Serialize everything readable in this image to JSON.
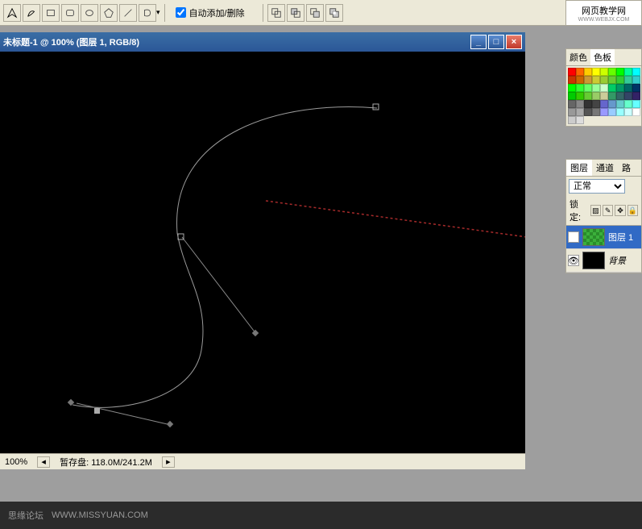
{
  "toolbar": {
    "checkbox_label": "自动添加/删除",
    "tool_icons": [
      "pen",
      "freeform-pen",
      "rect",
      "rounded-rect",
      "ellipse",
      "polygon",
      "line",
      "custom-shape"
    ],
    "group2_icons": [
      "path-combine",
      "path-subtract",
      "path-intersect",
      "path-exclude"
    ]
  },
  "logo": {
    "text": "网页教学网",
    "sub": "WWW.WEBJX.COM"
  },
  "panels": {
    "swatch": {
      "tabs": [
        "颜色",
        "色板"
      ],
      "active_tab": 1,
      "colors": [
        "#ff0000",
        "#ff6600",
        "#ffcc00",
        "#ffff00",
        "#ccff00",
        "#66ff00",
        "#00ff00",
        "#00ff99",
        "#00ffff",
        "#cc3300",
        "#cc6600",
        "#cc9933",
        "#cccc33",
        "#99cc33",
        "#66cc33",
        "#33cc33",
        "#33cc99",
        "#33cccc",
        "#00ff00",
        "#33ff33",
        "#66ff66",
        "#99ff99",
        "#ccffcc",
        "#00cc66",
        "#009966",
        "#006666",
        "#003366",
        "#00cc00",
        "#33cc00",
        "#66cc33",
        "#99cc66",
        "#cccc99",
        "#339966",
        "#336666",
        "#334466",
        "#332266",
        "#666666",
        "#888888",
        "#333333",
        "#444444",
        "#6666cc",
        "#6699cc",
        "#66cccc",
        "#66ffcc",
        "#66ffff",
        "#999999",
        "#aaaaaa",
        "#555555",
        "#777777",
        "#9999ff",
        "#99ccff",
        "#99ffff",
        "#ccffff",
        "#ffffff",
        "#cccccc",
        "#dddddd"
      ]
    },
    "layers": {
      "tabs": [
        "图层",
        "通道",
        "路"
      ],
      "active_tab": 0,
      "blend_mode": "正常",
      "lock_label": "锁定:",
      "rows": [
        {
          "name": "图层 1",
          "thumb": "green",
          "active": true
        },
        {
          "name": "背景",
          "thumb": "black",
          "active": false,
          "italic": true
        }
      ]
    }
  },
  "doc": {
    "title": "未标题-1 @ 100% (图层 1, RGB/8)",
    "status_zoom": "100%",
    "status_scratch": "暂存盘: 118.0M/241.2M"
  },
  "footer": {
    "forum": "思缘论坛",
    "url": "WWW.MISSYUAN.COM"
  }
}
